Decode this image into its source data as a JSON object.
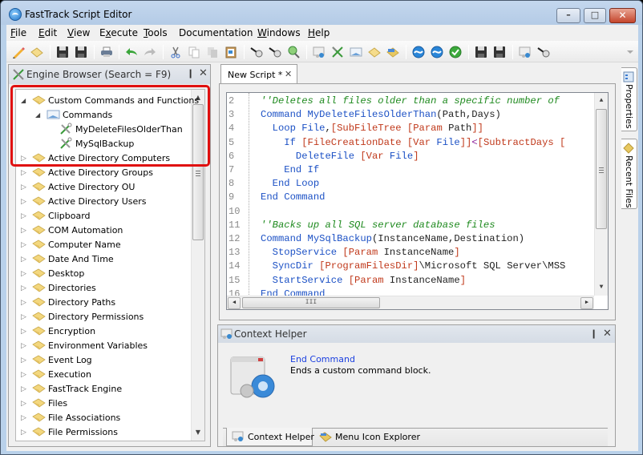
{
  "window": {
    "title": "FastTrack Script Editor",
    "controls": {
      "minimize": "–",
      "maximize": "□",
      "close": "✕"
    }
  },
  "menubar": [
    {
      "label": "File",
      "accel": "F",
      "rest": "ile"
    },
    {
      "label": "Edit",
      "accel": "E",
      "rest": "dit"
    },
    {
      "label": "View",
      "accel": "V",
      "rest": "iew"
    },
    {
      "label": "Execute",
      "accel": "",
      "pre": "E",
      "accel2": "x",
      "rest": "ecute"
    },
    {
      "label": "Tools",
      "accel": "T",
      "rest": "ools"
    },
    {
      "label": "Documentation",
      "accel": "",
      "rest": "Documentation"
    },
    {
      "label": "Windows",
      "accel": "W",
      "rest": "indows"
    },
    {
      "label": "Help",
      "accel": "H",
      "rest": "elp"
    }
  ],
  "toolbar": {
    "icons": [
      "pencil-icon",
      "eraser-icon",
      "save-icon",
      "save-as-icon",
      "print-icon",
      "undo-icon",
      "redo-icon",
      "cut-icon",
      "copy-icon",
      "paste-icon",
      "clipboard-icon",
      "find-icon",
      "find-next-icon",
      "find-replace-icon",
      "context-helper-icon",
      "engine-browser-icon",
      "image-icon",
      "folder-open-icon",
      "folder-browse-icon",
      "run-icon",
      "run-elevated-icon",
      "check-syntax-icon",
      "compile-icon",
      "compile-all-icon",
      "settings-icon",
      "search-icon"
    ]
  },
  "engine_browser": {
    "title": "Engine Browser (Search = F9)",
    "pin": "❙",
    "close": "✕",
    "tree": [
      {
        "label": "Custom Commands and Functions",
        "level": 0,
        "state": "expanded",
        "icon": "folder"
      },
      {
        "label": "Commands",
        "level": 1,
        "state": "expanded",
        "icon": "commands"
      },
      {
        "label": "MyDeleteFilesOlderThan",
        "level": 2,
        "state": "leaf",
        "icon": "tool"
      },
      {
        "label": "MySqlBackup",
        "level": 2,
        "state": "leaf",
        "icon": "tool"
      },
      {
        "label": "Active Directory Computers",
        "level": 0,
        "state": "collapsed",
        "icon": "folder"
      },
      {
        "label": "Active Directory Groups",
        "level": 0,
        "state": "collapsed",
        "icon": "folder"
      },
      {
        "label": "Active Directory OU",
        "level": 0,
        "state": "collapsed",
        "icon": "folder"
      },
      {
        "label": "Active Directory Users",
        "level": 0,
        "state": "collapsed",
        "icon": "folder"
      },
      {
        "label": "Clipboard",
        "level": 0,
        "state": "collapsed",
        "icon": "folder"
      },
      {
        "label": "COM Automation",
        "level": 0,
        "state": "collapsed",
        "icon": "folder"
      },
      {
        "label": "Computer Name",
        "level": 0,
        "state": "collapsed",
        "icon": "folder"
      },
      {
        "label": "Date And Time",
        "level": 0,
        "state": "collapsed",
        "icon": "folder"
      },
      {
        "label": "Desktop",
        "level": 0,
        "state": "collapsed",
        "icon": "folder"
      },
      {
        "label": "Directories",
        "level": 0,
        "state": "collapsed",
        "icon": "folder"
      },
      {
        "label": "Directory Paths",
        "level": 0,
        "state": "collapsed",
        "icon": "folder"
      },
      {
        "label": "Directory Permissions",
        "level": 0,
        "state": "collapsed",
        "icon": "folder"
      },
      {
        "label": "Encryption",
        "level": 0,
        "state": "collapsed",
        "icon": "folder"
      },
      {
        "label": "Environment Variables",
        "level": 0,
        "state": "collapsed",
        "icon": "folder"
      },
      {
        "label": "Event Log",
        "level": 0,
        "state": "collapsed",
        "icon": "folder"
      },
      {
        "label": "Execution",
        "level": 0,
        "state": "collapsed",
        "icon": "folder"
      },
      {
        "label": "FastTrack Engine",
        "level": 0,
        "state": "collapsed",
        "icon": "folder"
      },
      {
        "label": "Files",
        "level": 0,
        "state": "collapsed",
        "icon": "folder"
      },
      {
        "label": "File Associations",
        "level": 0,
        "state": "collapsed",
        "icon": "folder"
      },
      {
        "label": "File Permissions",
        "level": 0,
        "state": "collapsed",
        "icon": "folder"
      }
    ]
  },
  "editor": {
    "tab_label": "New Script *",
    "tab_close": "✕",
    "lines": [
      {
        "n": "2",
        "tokens": [
          [
            "cmt",
            "''Deletes all files older than a specific number of"
          ]
        ]
      },
      {
        "n": "3",
        "tokens": [
          [
            "kw",
            "Command "
          ],
          [
            "kw",
            "MyDeleteFilesOlderThan"
          ],
          [
            "txt",
            "(Path,Days)"
          ]
        ]
      },
      {
        "n": "4",
        "tokens": [
          [
            "kw",
            "  Loop "
          ],
          [
            "kw",
            "File"
          ],
          [
            "txt",
            ","
          ],
          [
            "fn",
            "[SubFileTree [Param "
          ],
          [
            "txt",
            "Path"
          ],
          [
            "fn",
            "]]"
          ]
        ]
      },
      {
        "n": "5",
        "tokens": [
          [
            "kw",
            "    If "
          ],
          [
            "fn",
            "[FileCreationDate [Var "
          ],
          [
            "kw",
            "File"
          ],
          [
            "fn",
            "]]"
          ],
          [
            "op",
            "<"
          ],
          [
            "fn",
            "[SubtractDays ["
          ]
        ]
      },
      {
        "n": "6",
        "tokens": [
          [
            "kw",
            "      DeleteFile "
          ],
          [
            "fn",
            "[Var "
          ],
          [
            "kw",
            "File"
          ],
          [
            "fn",
            "]"
          ]
        ]
      },
      {
        "n": "7",
        "tokens": [
          [
            "kw",
            "    End If"
          ]
        ]
      },
      {
        "n": "8",
        "tokens": [
          [
            "kw",
            "  End Loop"
          ]
        ]
      },
      {
        "n": "9",
        "tokens": [
          [
            "kw",
            "End Command"
          ]
        ]
      },
      {
        "n": "10",
        "tokens": []
      },
      {
        "n": "11",
        "tokens": [
          [
            "cmt",
            "''Backs up all SQL server database files"
          ]
        ]
      },
      {
        "n": "12",
        "tokens": [
          [
            "kw",
            "Command "
          ],
          [
            "kw",
            "MySqlBackup"
          ],
          [
            "txt",
            "(InstanceName,Destination)"
          ]
        ]
      },
      {
        "n": "13",
        "tokens": [
          [
            "kw",
            "  StopService "
          ],
          [
            "fn",
            "[Param "
          ],
          [
            "txt",
            "InstanceName"
          ],
          [
            "fn",
            "]"
          ]
        ]
      },
      {
        "n": "14",
        "tokens": [
          [
            "kw",
            "  SyncDir "
          ],
          [
            "fn",
            "[ProgramFilesDir]"
          ],
          [
            "txt",
            "\\Microsoft SQL Server\\MSS"
          ]
        ]
      },
      {
        "n": "15",
        "tokens": [
          [
            "kw",
            "  StartService "
          ],
          [
            "fn",
            "[Param "
          ],
          [
            "txt",
            "InstanceName"
          ],
          [
            "fn",
            "]"
          ]
        ]
      },
      {
        "n": "16",
        "tokens": [
          [
            "kw",
            "End Command"
          ]
        ]
      }
    ]
  },
  "side_tabs": [
    {
      "label": "Properties",
      "icon": "properties-icon"
    },
    {
      "label": "Recent Files",
      "icon": "recent-files-icon"
    }
  ],
  "context_helper": {
    "title": "Context Helper",
    "pin": "❙",
    "close": "✕",
    "command_name": "End Command",
    "description": "Ends a custom command block.",
    "tabs": [
      {
        "label": "Context Helper",
        "active": true,
        "icon": "context-helper-icon"
      },
      {
        "label": "Menu Icon Explorer",
        "active": false,
        "icon": "menu-icon-explorer-icon"
      }
    ]
  },
  "colors": {
    "highlight_box": "#e01010",
    "comment": "#1f8a1f",
    "keyword": "#1c51c5",
    "function": "#c0391b",
    "link": "#1a3fe0"
  }
}
